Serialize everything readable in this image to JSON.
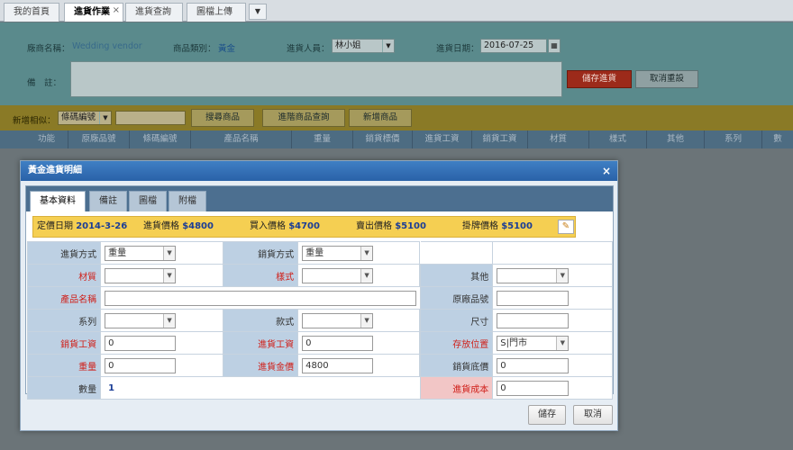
{
  "top_tabs": [
    {
      "label": "我的首頁"
    },
    {
      "label": "進貨作業"
    },
    {
      "label": "進貨查詢"
    },
    {
      "label": "圖檔上傳"
    }
  ],
  "top_tab_close": "×",
  "top_tab_dropdown": "▼",
  "bg": {
    "vendor_label": "廠商名稱：",
    "vendor_value": "Wedding vendor",
    "category_label": "商品類別：",
    "category_value": "黃金",
    "staff_label": "進貨人員：",
    "staff_value": "林小姐",
    "date_label": "進貨日期：",
    "date_value": "2016-07-25",
    "note_label": "備　註：",
    "save_btn": "儲存進貨",
    "cancel_btn": "取消重設",
    "add_like_label": "新增相似：",
    "add_like_select": "條碼編號",
    "search_btn": "搜尋商品",
    "advanced_btn": "進階商品查詢",
    "new_btn": "新增商品",
    "columns": [
      "功能",
      "原廠品號",
      "條碼編號",
      "產品名稱",
      "重量",
      "銷貨標價",
      "進貨工資",
      "銷貨工資",
      "材質",
      "樣式",
      "其他",
      "系列",
      "數"
    ]
  },
  "modal": {
    "title": "黃金進貨明細",
    "close": "×",
    "tabs": [
      "基本資料",
      "備註",
      "圖檔",
      "附檔"
    ],
    "prices": {
      "date_label": "定價日期",
      "date_value": "2014-3-26",
      "purchase_label": "進貨價格",
      "purchase_value": "$4800",
      "buy_label": "買入價格",
      "buy_value": "$4700",
      "sell_label": "賣出價格",
      "sell_value": "$5100",
      "tag_label": "掛牌價格",
      "tag_value": "$5100"
    },
    "fields": {
      "purchase_method_label": "進貨方式",
      "purchase_method_value": "重量",
      "sale_method_label": "銷貨方式",
      "sale_method_value": "重量",
      "material_label": "材質",
      "style_label": "樣式",
      "other_label": "其他",
      "product_name_label": "產品名稱",
      "vendor_code_label": "原廠品號",
      "series_label": "系列",
      "model_label": "款式",
      "size_label": "尺寸",
      "sales_wage_label": "銷貨工資",
      "sales_wage_value": "0",
      "purchase_wage_label": "進貨工資",
      "purchase_wage_value": "0",
      "storage_label": "存放位置",
      "storage_value": "S|門市",
      "weight_label": "重量",
      "weight_value": "0",
      "purchase_amount_label": "進貨金價",
      "purchase_amount_value": "4800",
      "sales_floor_label": "銷貨底價",
      "sales_floor_value": "0",
      "quantity_label": "數量",
      "quantity_value": "1",
      "purchase_cost_label": "進貨成本",
      "purchase_cost_value": "0"
    },
    "save_btn": "儲存",
    "cancel_btn": "取消"
  },
  "icons": {
    "edit": "pencil-icon",
    "dropdown": "chevron-down-icon",
    "calendar": "calendar-icon"
  }
}
